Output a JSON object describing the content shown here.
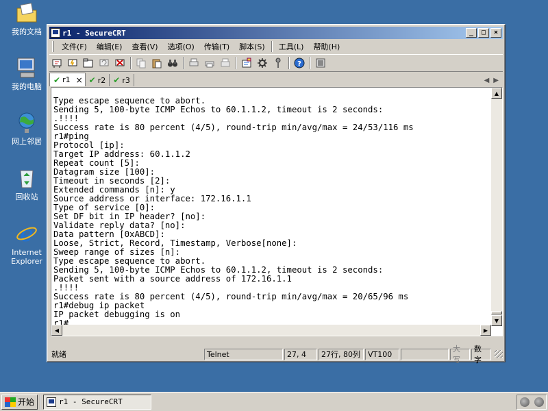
{
  "desktop": {
    "icons": [
      {
        "label": "我的文档",
        "icon": "my-documents-icon"
      },
      {
        "label": "我的电脑",
        "icon": "my-computer-icon"
      },
      {
        "label": "网上邻居",
        "icon": "network-places-icon"
      },
      {
        "label": "回收站",
        "icon": "recycle-bin-icon"
      },
      {
        "label": "Internet Explorer",
        "icon": "internet-explorer-icon"
      }
    ]
  },
  "window": {
    "title": "r1 - SecureCRT",
    "controls": {
      "minimize": "_",
      "maximize": "□",
      "close": "×"
    },
    "menu": [
      "文件(F)",
      "编辑(E)",
      "查看(V)",
      "选项(O)",
      "传输(T)",
      "脚本(S)",
      "工具(L)",
      "帮助(H)"
    ],
    "tabs": [
      {
        "label": "r1",
        "active": true,
        "close": "×"
      },
      {
        "label": "r2",
        "active": false
      },
      {
        "label": "r3",
        "active": false
      }
    ],
    "terminal_lines": [
      "Type escape sequence to abort.",
      "Sending 5, 100-byte ICMP Echos to 60.1.1.2, timeout is 2 seconds:",
      ".!!!!",
      "Success rate is 80 percent (4/5), round-trip min/avg/max = 24/53/116 ms",
      "r1#ping",
      "Protocol [ip]:",
      "Target IP address: 60.1.1.2",
      "Repeat count [5]:",
      "Datagram size [100]:",
      "Timeout in seconds [2]:",
      "Extended commands [n]: y",
      "Source address or interface: 172.16.1.1",
      "Type of service [0]:",
      "Set DF bit in IP header? [no]:",
      "Validate reply data? [no]:",
      "Data pattern [0xABCD]:",
      "Loose, Strict, Record, Timestamp, Verbose[none]:",
      "Sweep range of sizes [n]:",
      "Type escape sequence to abort.",
      "Sending 5, 100-byte ICMP Echos to 60.1.1.2, timeout is 2 seconds:",
      "Packet sent with a source address of 172.16.1.1",
      ".!!!!",
      "Success rate is 80 percent (4/5), round-trip min/avg/max = 20/65/96 ms",
      "r1#debug ip packet",
      "IP packet debugging is on",
      "r1#"
    ],
    "status": {
      "ready": "就绪",
      "protocol": "Telnet",
      "cursor": "27,  4",
      "size": "27行, 80列",
      "emulation": "VT100",
      "blank": "",
      "caps": "大写",
      "num": "数字"
    }
  },
  "taskbar": {
    "start_label": "开始",
    "task_label": "r1 - SecureCRT"
  }
}
